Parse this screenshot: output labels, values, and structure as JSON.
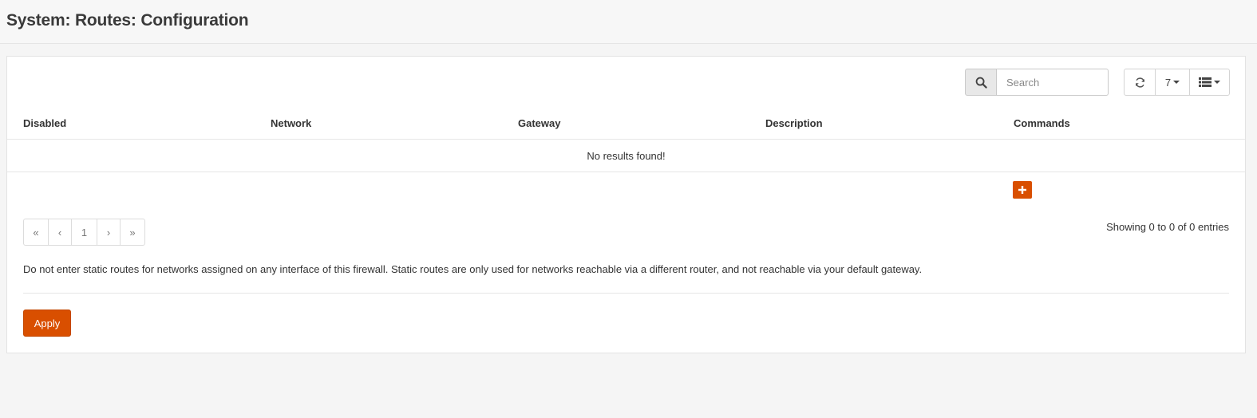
{
  "page": {
    "title": "System: Routes: Configuration"
  },
  "toolbar": {
    "search_placeholder": "Search",
    "search_icon": "search-icon",
    "refresh_icon": "refresh-icon",
    "rows_per_page": "7",
    "columns_icon": "list-columns-icon"
  },
  "table": {
    "columns": [
      "Disabled",
      "Network",
      "Gateway",
      "Description",
      "Commands"
    ],
    "empty_message": "No results found!",
    "add_icon": "plus-icon"
  },
  "pagination": {
    "first": "«",
    "prev": "‹",
    "current": "1",
    "next": "›",
    "last": "»",
    "showing": "Showing 0 to 0 of 0 entries"
  },
  "note": "Do not enter static routes for networks assigned on any interface of this firewall. Static routes are only used for networks reachable via a different router, and not reachable via your default gateway.",
  "actions": {
    "apply_label": "Apply"
  },
  "colors": {
    "accent": "#d94f00"
  }
}
